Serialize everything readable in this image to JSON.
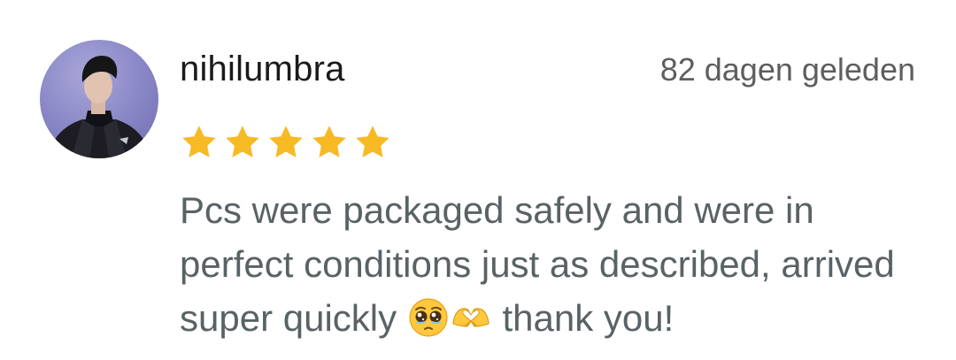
{
  "review": {
    "username": "nihilumbra",
    "timestamp": "82 dagen geleden",
    "rating": 5,
    "rating_max": 5,
    "text_before_emoji": "Pcs were packaged safely and were in perfect conditions just as described, arrived super quickly ",
    "emojis": [
      "pleading-face-emoji",
      "heart-hands-emoji"
    ],
    "text_after_emoji": " thank you!"
  },
  "colors": {
    "star": "#F7B924",
    "username": "#1a1a1a",
    "timestamp": "#5e5e5e",
    "body_text": "#596265",
    "avatar_bg": "#8d8ac9"
  }
}
